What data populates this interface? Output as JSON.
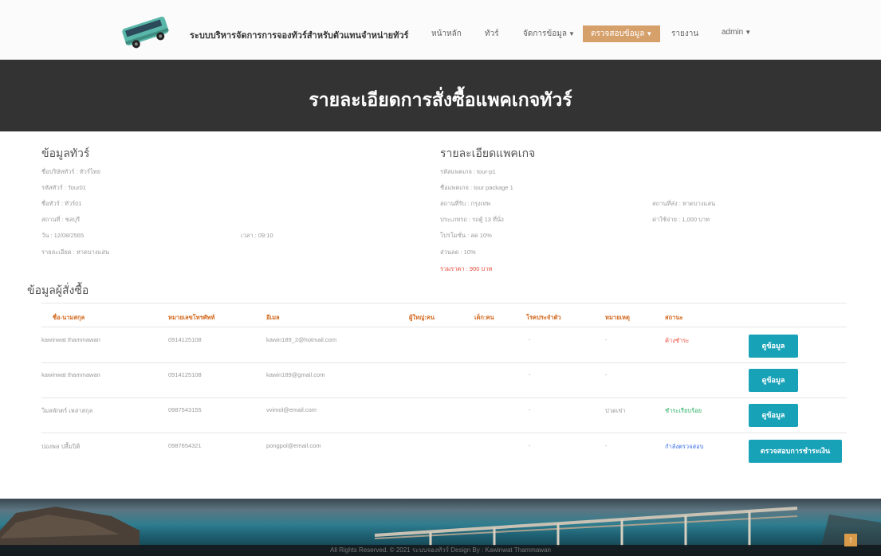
{
  "nav": {
    "brand": "ระบบบริหารจัดการการจองทัวร์สำหรับตัวแทนจำหน่ายทัวร์",
    "items": [
      "หน้าหลัก",
      "ทัวร์",
      "จัดการข้อมูล",
      "ตรวจสอบข้อมูล",
      "รายงาน",
      "admin"
    ],
    "active_color": "#d6a06b"
  },
  "hero": {
    "title": "รายละเอียดการสั่งซื้อแพคเกจทัวร์"
  },
  "tour_info": {
    "title": "ข้อมูลทัวร์",
    "company": "ชื่อบริษัททัวร์ : ทัวร์ไทย",
    "tour_code": "รหัสทัวร์ : Tour01",
    "tour_name": "ชื่อทัวร์ : ทัวร์01",
    "place": "สถานที่ : ชลบุรี",
    "date": "วัน : 12/08/2565",
    "time": "เวลา : 09:10",
    "detail": "รายละเอียด : หาดบางแสน"
  },
  "package_info": {
    "title": "รายละเอียดแพคเกจ",
    "code": "รหัสแพคเกจ : tour-p1",
    "name": "ชื่อแพคเกจ : tour package 1",
    "pickup": "สถานที่รับ : กรุงเทพ",
    "dropoff": "สถานที่ส่ง : หาดบางแสน",
    "type": "ประเภทรถ : รถตู้ 13 ที่นั่ง",
    "price": "ค่าใช้จ่าย : 1,000 บาท",
    "promo": "โปรโมชั่น : ลด 10%",
    "discount": "ส่วนลด : 10%",
    "total": "รวมราคา : 900 บาท"
  },
  "buyers": {
    "title": "ข้อมูลผู้สั่งซื้อ",
    "columns": [
      "ชื่อ-นามสกุล",
      "หมายเลขโทรศัพท์",
      "อีเมล",
      "ผู้ใหญ่:คน",
      "เด็ก:คน",
      "โรคประจำตัว",
      "หมายเหตุ",
      "สถานะ"
    ],
    "rows": [
      {
        "name": "kawinwat thammawan",
        "phone": "0914125108",
        "email": "kawin189_2@hotmail.com",
        "adult": "",
        "child": "",
        "disease": "-",
        "note": "-",
        "status": "ค้างชำระ",
        "status_color": "#e74c3c",
        "action": "ดูข้อมูล"
      },
      {
        "name": "kawinwat thammawan",
        "phone": "0914125108",
        "email": "kawin189@gmail.com",
        "adult": "",
        "child": "",
        "disease": "-",
        "note": "-",
        "status": "",
        "status_color": "#e74c3c",
        "action": "ดูข้อมูล"
      },
      {
        "name": "วิมลพักตร์ เหล่าสกุล",
        "phone": "0987543155",
        "email": "vvimol@email.com",
        "adult": "",
        "child": "",
        "disease": "-",
        "note": "ปวดเข่า",
        "status": "ชำระเรียบร้อย",
        "status_color": "#27ae60",
        "action": "ดูข้อมูล"
      },
      {
        "name": "ปองพล ปลื้มปิติ",
        "phone": "0987654321",
        "email": "pongpol@email.com",
        "adult": "",
        "child": "",
        "disease": "-",
        "note": "-",
        "status": "กำลังตรวจสอบ",
        "status_color": "#3a6ee8",
        "action": "ตรวจสอบการชำระเงิน"
      }
    ],
    "button_color": "#17a2b8"
  },
  "footer": {
    "text": "All Rights Reserved. © 2021 ระบบจองทัวร์ Design By : Kawinwat Thammawan"
  },
  "icons": {
    "logo": "bus-icon",
    "scroll_top": "arrow-up-icon"
  }
}
